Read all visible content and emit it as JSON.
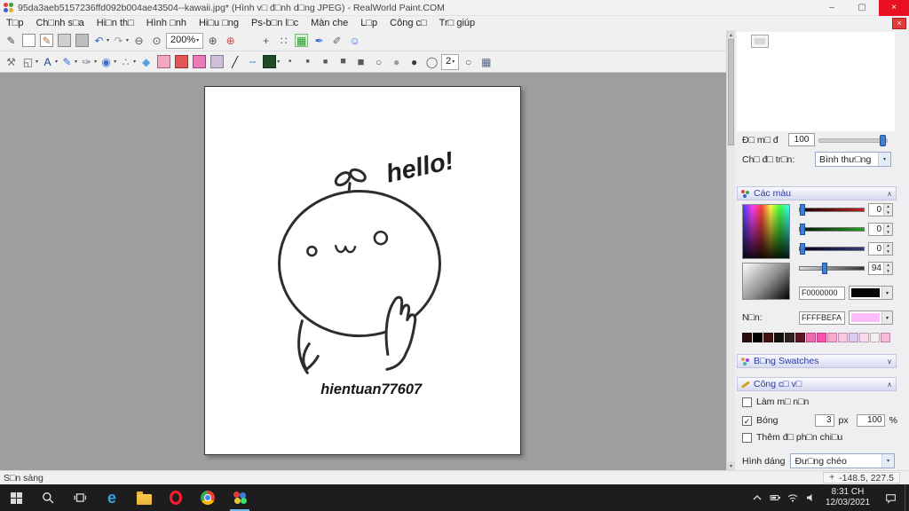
{
  "glyphs": {
    "dd": "▾",
    "up": "▴",
    "down": "▾",
    "spin_up": "▲",
    "spin_down": "▼",
    "chev_up": "∧",
    "chev_down": "∨",
    "check": "✓",
    "close": "×",
    "min": "–",
    "max": "▢",
    "crosshair": "+"
  },
  "window": {
    "title": "95da3aeb5157236ffd092b004ae43504--kawaii.jpg* (Hình v□ đ□nh d□ng JPEG) - RealWorld Paint.COM"
  },
  "menu": {
    "items": [
      "T□p",
      "Ch□nh s□a",
      "Hi□n th□",
      "Hình □nh",
      "Hi□u □ng",
      "Ps-b□n l□c",
      "Màn che",
      "L□p",
      "Công c□",
      "Tr□ giúp"
    ]
  },
  "toolbar_top": {
    "buttons": [
      {
        "name": "pen-settings-icon",
        "glyph": "✎",
        "fg": "#4a4a4a"
      },
      {
        "name": "new-image-icon",
        "glyph": "",
        "bg": "#ffffff",
        "bd": "#909090"
      },
      {
        "name": "open-image-icon",
        "glyph": "✎",
        "fg": "#b07040",
        "bg": "#ffffff",
        "bd": "#909090"
      },
      {
        "name": "import-device-icon",
        "glyph": "",
        "bg": "#cfcfcf",
        "bd": "#8a8a8a"
      },
      {
        "name": "export-device-icon",
        "glyph": "",
        "bg": "#bdbdbd",
        "bd": "#8a8a8a"
      },
      {
        "name": "undo-icon",
        "glyph": "↶",
        "fg": "#2f6fd0",
        "dd": true
      },
      {
        "name": "redo-icon",
        "glyph": "↷",
        "fg": "#a0a0a0",
        "dd": true
      },
      {
        "name": "zoom-out-icon",
        "glyph": "⊖",
        "fg": "#555555"
      },
      {
        "name": "zoom-actual-icon",
        "glyph": "⊙",
        "fg": "#555555"
      },
      {
        "name": "zoom-level-select",
        "glyph": "200%",
        "dd": true,
        "combo": true
      },
      {
        "name": "zoom-in-icon",
        "glyph": "⊕",
        "fg": "#555555"
      },
      {
        "name": "zoom-region-icon",
        "glyph": "⊕",
        "fg": "#d04545"
      },
      {
        "name": "select-rectangle-icon",
        "glyph": "",
        "dashed": true
      },
      {
        "name": "select-add-icon",
        "glyph": "+",
        "fg": "#555555",
        "dashed": true
      },
      {
        "name": "select-handles-icon",
        "glyph": "∷",
        "fg": "#555555",
        "dashed": true
      },
      {
        "name": "transparency-grid-icon",
        "glyph": "▦",
        "fg": "#2e9e2e",
        "bg": "#d8f0d8",
        "bd": "#7ab87a"
      },
      {
        "name": "color-picker-pen-icon",
        "glyph": "✒",
        "fg": "#3a6fd0"
      },
      {
        "name": "pencil-icon",
        "glyph": "✐",
        "fg": "#666666"
      },
      {
        "name": "profile-icon",
        "glyph": "☺",
        "fg": "#3a6fd0"
      }
    ]
  },
  "toolbar_tools": {
    "buttons": [
      {
        "name": "wrench-icon",
        "glyph": "⚒",
        "fg": "#707070"
      },
      {
        "name": "transform-icon",
        "glyph": "◱",
        "fg": "#555555",
        "dd": true
      },
      {
        "name": "text-tool-icon",
        "glyph": "A",
        "fg": "#16418c",
        "dd": true
      },
      {
        "name": "brush-tool-icon",
        "glyph": "✎",
        "fg": "#2f6fd0",
        "dd": true
      },
      {
        "name": "pen-tool-icon",
        "glyph": "✑",
        "fg": "#58748c",
        "dd": true
      },
      {
        "name": "shape-tool-icon",
        "glyph": "◉",
        "fg": "#2f6fd0",
        "dd": true
      },
      {
        "name": "spray-tool-icon",
        "glyph": "∴",
        "fg": "#707070",
        "dd": true
      },
      {
        "name": "water-drop-icon",
        "glyph": "◆",
        "fg": "#5aa0e0"
      },
      {
        "name": "eraser-icon",
        "glyph": "",
        "bg": "#f2a7c3",
        "bd": "#b06080"
      },
      {
        "name": "clone-stamp-icon",
        "glyph": "",
        "bg": "#e05555",
        "bd": "#a03030"
      },
      {
        "name": "pattern-stamp-icon",
        "glyph": "",
        "bg": "#ea7ab8",
        "bd": "#a04080"
      },
      {
        "name": "history-stamp-icon",
        "glyph": "",
        "bg": "#cdbfda",
        "bd": "#8a7a9a"
      },
      {
        "name": "line-solid-icon",
        "glyph": "╱",
        "fg": "#181818"
      },
      {
        "name": "line-dashed-icon",
        "glyph": "╌",
        "fg": "#2f6fd0"
      },
      {
        "name": "fill-style-select",
        "glyph": "",
        "bg": "#1e4d23",
        "bd": "#123015",
        "dd": true
      },
      {
        "name": "width-1-icon",
        "glyph": "■",
        "fg": "#5a5a5a",
        "fs": 5
      },
      {
        "name": "width-2-icon",
        "glyph": "■",
        "fg": "#5a5a5a",
        "fs": 7
      },
      {
        "name": "width-3-icon",
        "glyph": "■",
        "fg": "#5a5a5a",
        "fs": 9
      },
      {
        "name": "width-4-icon",
        "glyph": "■",
        "fg": "#5a5a5a",
        "fs": 11
      },
      {
        "name": "width-5-icon",
        "glyph": "■",
        "fg": "#5a5a5a",
        "fs": 13
      },
      {
        "name": "cap-outline-icon",
        "glyph": "○",
        "fg": "#555555"
      },
      {
        "name": "cap-mid-icon",
        "glyph": "●",
        "fg": "#9a9a9a"
      },
      {
        "name": "cap-solid-icon",
        "glyph": "●",
        "fg": "#3a3a3a"
      },
      {
        "name": "ellipse-outline-icon",
        "glyph": "◯",
        "fg": "#555555"
      },
      {
        "name": "line-width-select",
        "glyph": "2",
        "dd": true,
        "combo": true
      },
      {
        "name": "circle-outline2-icon",
        "glyph": "○",
        "fg": "#555555"
      },
      {
        "name": "grid-icon",
        "glyph": "▦",
        "fg": "#5a6a8a"
      }
    ]
  },
  "canvas": {
    "hello_text": "hello!",
    "signature": "hientuan77607"
  },
  "layers_panel": {
    "opacity_label": "Đ□ m□ đ",
    "opacity_value": "100",
    "blend_label": "Ch□ đ□ tr□n:",
    "blend_value": "Bình thư□ng"
  },
  "colors_panel": {
    "header": "Các màu",
    "sliders": [
      {
        "name": "red-slider",
        "value": "0"
      },
      {
        "name": "green-slider",
        "value": "0"
      },
      {
        "name": "blue-slider",
        "value": "0"
      },
      {
        "name": "alpha-slider",
        "value": "94"
      }
    ],
    "foreground_hex": "F0000000",
    "foreground_color": "#050505",
    "background_label": "N□n:",
    "background_hex": "FFFFBEFA",
    "background_color": "#ffbefa",
    "swatches": [
      "#2b0d0d",
      "#000000",
      "#431111",
      "#101010",
      "#30221f",
      "#5c1626",
      "#f06aaf",
      "#ff4fae",
      "#f9a8d0",
      "#fbc9e2",
      "#ddc8ef",
      "#fcd9ec",
      "#f4eef1",
      "#f8b9d9"
    ]
  },
  "swatches_panel": {
    "header": "B□ng Swatches"
  },
  "tool_options": {
    "header": "Công c□ v□",
    "smooth_label": "Làm m□ n□n",
    "shadow_label": "Bóng",
    "shadow_size": "3",
    "shadow_size_unit": "px",
    "shadow_opacity": "100",
    "shadow_opacity_unit": "%",
    "reflect_label": "Thêm đ□ ph□n chi□u",
    "shape_label": "Hình dáng",
    "shape_value": "Đư□ng chéo"
  },
  "status_bar": {
    "ready": "S□n sàng",
    "coords": "-148.5, 227.5"
  },
  "taskbar": {
    "time": "8:31 CH",
    "date": "12/03/2021",
    "apps": [
      "start",
      "search",
      "task-view",
      "edge",
      "file-explorer",
      "opera",
      "chrome",
      "realworld-paint"
    ],
    "tray": [
      "hidden-icons",
      "battery",
      "network",
      "volume",
      "clock",
      "action-center"
    ]
  }
}
